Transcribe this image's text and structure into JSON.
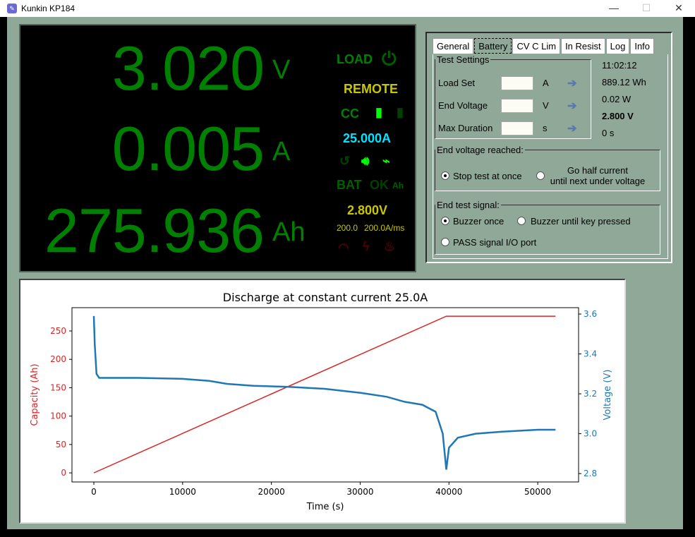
{
  "window": {
    "title": "Kunkin KP184",
    "min": "—",
    "max": "☐",
    "close": "✕"
  },
  "display": {
    "voltage": "3.020",
    "voltage_unit": "V",
    "current": "0.005",
    "current_unit": "A",
    "capacity": "275.936",
    "capacity_unit": "Ah",
    "load": "LOAD",
    "remote": "REMOTE",
    "mode": "CC",
    "set_current": "25.000A",
    "bat": "BAT",
    "ok": "OK",
    "ah": "Ah",
    "end_voltage": "2.800V",
    "slew1": "200.0",
    "slew2": "200.0A/ms"
  },
  "tabs": [
    {
      "label": "General"
    },
    {
      "label": "Battery",
      "active": true
    },
    {
      "label": "CV C Lim"
    },
    {
      "label": "In Resist"
    },
    {
      "label": "Log"
    },
    {
      "label": "Info"
    }
  ],
  "test_settings": {
    "legend": "Test Settings",
    "rows": [
      {
        "label": "Load Set",
        "value": "",
        "unit": "A"
      },
      {
        "label": "End Voltage",
        "value": "",
        "unit": "V"
      },
      {
        "label": "Max Duration",
        "value": "",
        "unit": "s"
      }
    ]
  },
  "readouts": {
    "time": "11:02:12",
    "energy": "889.12 Wh",
    "power": "0.02 W",
    "end_voltage": "2.800 V",
    "duration": "0 s"
  },
  "end_voltage_reached": {
    "legend": "End voltage reached:",
    "opt1": "Stop test at once",
    "opt2a": "Go half current",
    "opt2b": "until next under voltage",
    "selected": 1
  },
  "end_test_signal": {
    "legend": "End test signal:",
    "opt1": "Buzzer once",
    "opt2": "Buzzer until key pressed",
    "opt3": "PASS signal I/O port",
    "selected": 1
  },
  "chart_data": {
    "type": "line",
    "title": "Discharge at constant current 25.0A",
    "xlabel": "Time (s)",
    "ylabel": "Capacity (Ah)",
    "y2label": "Voltage (V)",
    "xlim": [
      -2464,
      54600
    ],
    "ylim": [
      -16,
      291
    ],
    "y2lim": [
      2.758,
      3.632
    ],
    "xticks": [
      0,
      10000,
      20000,
      30000,
      40000,
      50000
    ],
    "yticks": [
      0,
      50,
      100,
      150,
      200,
      250
    ],
    "y2ticks": [
      2.8,
      3.0,
      3.2,
      3.4,
      3.6
    ],
    "colors": {
      "capacity": "#d62728",
      "voltage": "#1f77b4"
    },
    "series": [
      {
        "axis": "left",
        "color": "#d62728",
        "x": [
          0,
          39700,
          52000
        ],
        "y": [
          0,
          276,
          276
        ]
      },
      {
        "axis": "right",
        "color": "#1f77b4",
        "x": [
          0,
          100,
          300,
          600,
          5000,
          10000,
          13000,
          15000,
          18000,
          22000,
          26000,
          30000,
          33000,
          35000,
          37000,
          38500,
          39300,
          39700,
          40000,
          41000,
          43000,
          46000,
          50000,
          52000
        ],
        "y": [
          3.59,
          3.45,
          3.3,
          3.28,
          3.28,
          3.275,
          3.265,
          3.25,
          3.24,
          3.235,
          3.225,
          3.205,
          3.185,
          3.16,
          3.145,
          3.11,
          3.0,
          2.82,
          2.93,
          2.98,
          3.0,
          3.01,
          3.02,
          3.02
        ]
      }
    ]
  }
}
